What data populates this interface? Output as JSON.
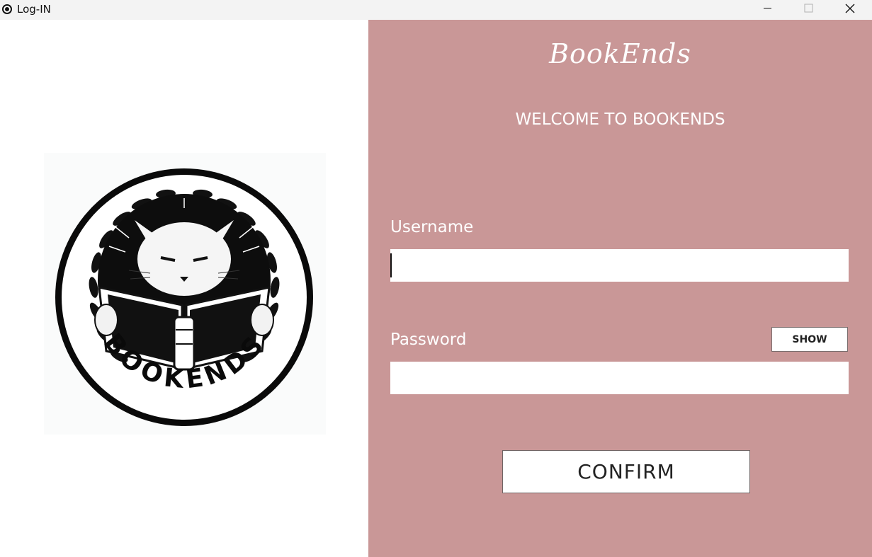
{
  "window": {
    "title": "Log-IN",
    "controls": [
      "minimize",
      "maximize",
      "close"
    ]
  },
  "logo": {
    "text": "BOOKENDS",
    "description_icon": "cat-reading-book-emblem"
  },
  "form": {
    "brand": "BookEnds",
    "welcome": "WELCOME TO BOOKENDS",
    "username_label": "Username",
    "username_value": "",
    "password_label": "Password",
    "password_value": "",
    "show_label": "SHOW",
    "confirm_label": "CONFIRM"
  },
  "colors": {
    "panel_bg": "#c99797",
    "text": "#ffffff"
  }
}
